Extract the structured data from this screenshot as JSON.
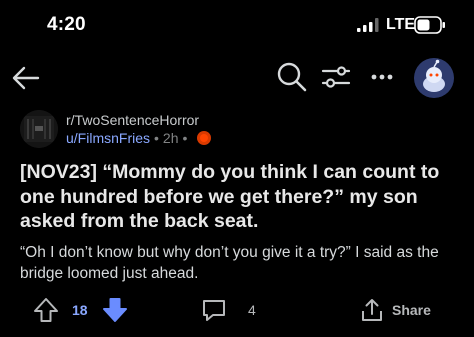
{
  "status_bar": {
    "time": "4:20",
    "network": "LTE",
    "icons": [
      "signal-bars-icon",
      "battery-icon"
    ]
  },
  "topbar": {
    "icons": [
      "back-arrow-icon",
      "search-icon",
      "filter-icon",
      "more-icon",
      "user-avatar-icon"
    ]
  },
  "post": {
    "subreddit": "r/TwoSentenceHorror",
    "author": "u/FilmsnFries",
    "separator": "•",
    "age": "2h",
    "title": "[NOV23] “Mommy do you think I can count to one hundred before we get there?” my son asked from the back seat.",
    "body": "“Oh I don’t know but why don’t you give it a try?” I said as the bridge loomed just ahead."
  },
  "actions": {
    "votes": "18",
    "comments": "4",
    "share_label": "Share"
  },
  "colors": {
    "background": "#000000",
    "accent_blue": "#8aa8ff",
    "downvote_blue": "#6a8cff",
    "award_red": "#ff4500"
  }
}
